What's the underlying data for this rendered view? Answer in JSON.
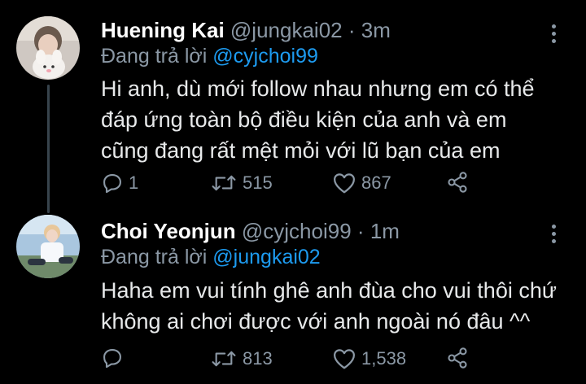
{
  "tweets": [
    {
      "name": "Huening Kai",
      "handle": "@jungkai02",
      "separator": "·",
      "time": "3m",
      "reply_prefix": "Đang trả lời",
      "reply_to": "@cyjchoi99",
      "lines": [
        "Hi anh, dù mới follow nhau nhưng em có thể",
        "đáp ứng toàn bộ điều kiện của anh và em",
        "cũng đang rất mệt mỏi với lũ bạn của em"
      ],
      "replies": "1",
      "retweets": "515",
      "likes": "867"
    },
    {
      "name": "Choi Yeonjun",
      "handle": "@cyjchoi99",
      "separator": "·",
      "time": "1m",
      "reply_prefix": "Đang trả lời",
      "reply_to": "@jungkai02",
      "lines": [
        "Haha em vui tính ghê anh đùa cho vui thôi chứ",
        "không ai chơi được với anh ngoài nó đâu ^^"
      ],
      "replies": "",
      "retweets": "813",
      "likes": "1,538"
    }
  ],
  "icons": {
    "reply": "reply-icon",
    "retweet": "retweet-icon",
    "like": "heart-icon",
    "share": "share-icon",
    "more": "more-icon"
  },
  "colors": {
    "background": "#000000",
    "text": "#e7e9ea",
    "muted": "#8b98a5",
    "link": "#1d9bf0",
    "thread_line": "#38444d"
  }
}
